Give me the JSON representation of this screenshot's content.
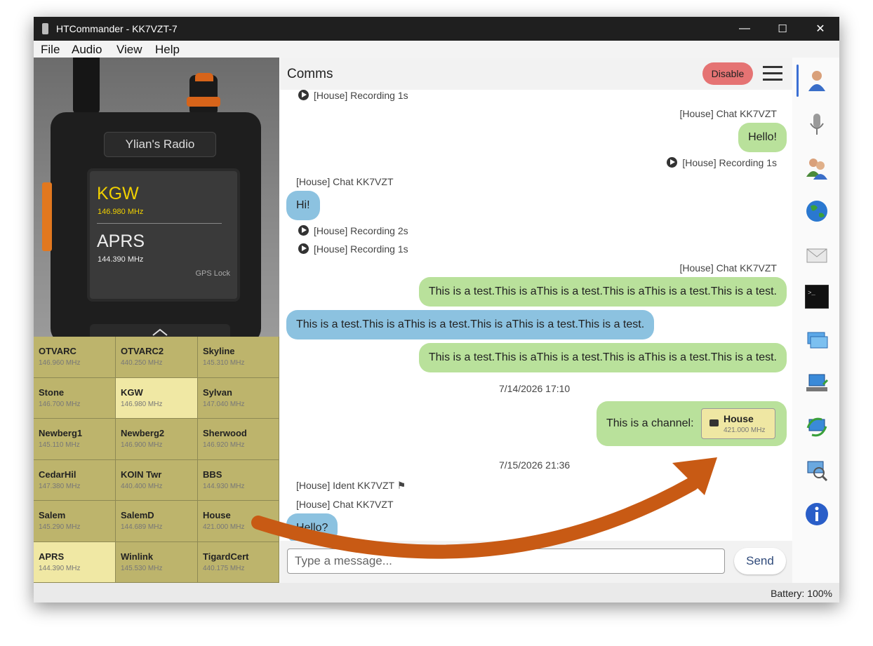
{
  "window": {
    "title": "HTCommander - KK7VZT-7",
    "minimize": "—",
    "maximize": "☐",
    "close": "✕"
  },
  "menu": [
    "File",
    "Audio",
    "View",
    "Help"
  ],
  "radio": {
    "plate_label": "Ylian's Radio",
    "vfo_a_name": "KGW",
    "vfo_a_freq": "146.980 MHz",
    "vfo_b_name": "APRS",
    "vfo_b_freq": "144.390 MHz",
    "gps_status": "GPS Lock",
    "accent_color": "#d7641a",
    "display_active_color": "#f0d000"
  },
  "channels": [
    {
      "name": "OTVARC",
      "freq": "146.960 MHz",
      "active": false
    },
    {
      "name": "OTVARC2",
      "freq": "440.250 MHz",
      "active": false
    },
    {
      "name": "Skyline",
      "freq": "145.310 MHz",
      "active": false
    },
    {
      "name": "Stone",
      "freq": "146.700 MHz",
      "active": false
    },
    {
      "name": "KGW",
      "freq": "146.980 MHz",
      "active": true
    },
    {
      "name": "Sylvan",
      "freq": "147.040 MHz",
      "active": false
    },
    {
      "name": "Newberg1",
      "freq": "145.110 MHz",
      "active": false
    },
    {
      "name": "Newberg2",
      "freq": "146.900 MHz",
      "active": false
    },
    {
      "name": "Sherwood",
      "freq": "146.920 MHz",
      "active": false
    },
    {
      "name": "CedarHil",
      "freq": "147.380 MHz",
      "active": false
    },
    {
      "name": "KOIN Twr",
      "freq": "440.400 MHz",
      "active": false
    },
    {
      "name": "BBS",
      "freq": "144.930 MHz",
      "active": false
    },
    {
      "name": "Salem",
      "freq": "145.290 MHz",
      "active": false
    },
    {
      "name": "SalemD",
      "freq": "144.689 MHz",
      "active": false
    },
    {
      "name": "House",
      "freq": "421.000 MHz",
      "active": false
    },
    {
      "name": "APRS",
      "freq": "144.390 MHz",
      "active": true
    },
    {
      "name": "Winlink",
      "freq": "145.530 MHz",
      "active": false
    },
    {
      "name": "TigardCert",
      "freq": "440.175 MHz",
      "active": false
    }
  ],
  "comms": {
    "title": "Comms",
    "disable_label": "Disable",
    "input_placeholder": "Type a message...",
    "send_label": "Send",
    "messages": {
      "rec1": "[House] Recording 1s",
      "chat_hdr_out1": "[House] Chat KK7VZT",
      "hello_out": "Hello!",
      "rec2": "[House] Recording 1s",
      "chat_hdr_in1": "[House] Chat KK7VZT",
      "hi_in": "Hi!",
      "rec3": "[House] Recording 2s",
      "rec4": "[House] Recording 1s",
      "chat_hdr_out2": "[House] Chat KK7VZT",
      "test_out1": "This is a test.This is aThis is a test.This is aThis is a test.This is a test.",
      "test_in": "This is a test.This is aThis is a test.This is aThis is a test.This is a test.",
      "test_out2": "This is a test.This is aThis is a test.This is aThis is a test.This is a test.",
      "date1": "7/14/2026 17:10",
      "channel_msg": "This is a channel:",
      "channel_chip_name": "House",
      "channel_chip_freq": "421.000 MHz",
      "date2": "7/15/2026 21:36",
      "ident_hdr": "[House] Ident KK7VZT",
      "chat_hdr_in2": "[House] Chat KK7VZT",
      "hello_in": "Hello?"
    },
    "colors": {
      "outgoing_bubble": "#b9e19b",
      "incoming_bubble": "#8cc2e0",
      "disable_button": "#e57373"
    }
  },
  "sidebar_icons": [
    "contact-icon",
    "microphone-icon",
    "users-icon",
    "globe-icon",
    "mail-icon",
    "terminal-icon",
    "windows-icon",
    "network-icon",
    "network-sync-icon",
    "search-network-icon",
    "info-icon"
  ],
  "status": {
    "battery": "Battery: 100%"
  },
  "annotation": {
    "arrow_color": "#c85a14"
  }
}
